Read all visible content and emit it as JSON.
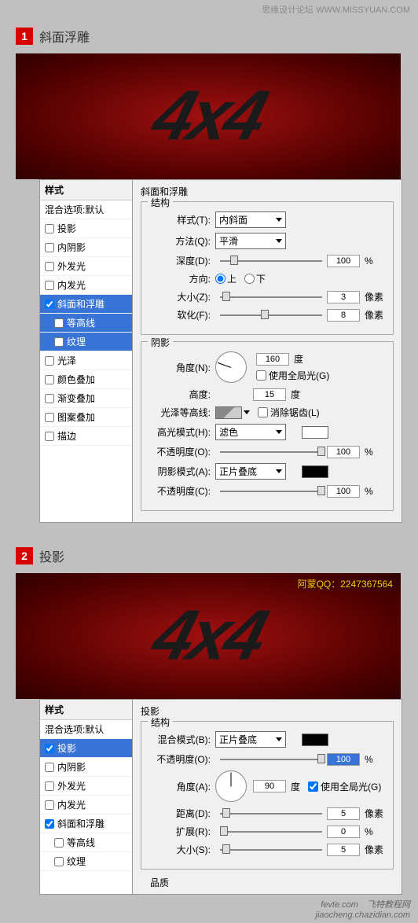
{
  "header_link": "思缘设计论坛 WWW.MISSYUAN.COM",
  "section1": {
    "number": "1",
    "title": "斜面浮雕"
  },
  "section2": {
    "number": "2",
    "title": "投影"
  },
  "preview_text": "4x4",
  "watermark_qq": "阿蒙QQ：2247367564",
  "style_panel": {
    "header": "样式",
    "blend_options": "混合选项:默认",
    "items": {
      "drop_shadow": "投影",
      "inner_shadow": "内阴影",
      "outer_glow": "外发光",
      "inner_glow": "内发光",
      "bevel_emboss": "斜面和浮雕",
      "contour": "等高线",
      "texture": "纹理",
      "satin": "光泽",
      "color_overlay": "颜色叠加",
      "gradient_overlay": "渐变叠加",
      "pattern_overlay": "图案叠加",
      "stroke": "描边"
    }
  },
  "bevel": {
    "panel_title": "斜面和浮雕",
    "structure": "结构",
    "style_label": "样式(T):",
    "style_value": "内斜面",
    "technique_label": "方法(Q):",
    "technique_value": "平滑",
    "depth_label": "深度(D):",
    "depth_value": "100",
    "direction_label": "方向:",
    "direction_up": "上",
    "direction_down": "下",
    "size_label": "大小(Z):",
    "size_value": "3",
    "soften_label": "软化(F):",
    "soften_value": "8",
    "pixel_unit": "像素",
    "percent_unit": "%",
    "shading": "阴影",
    "angle_label": "角度(N):",
    "angle_value": "160",
    "degree_unit": "度",
    "global_light": "使用全局光(G)",
    "altitude_label": "高度:",
    "altitude_value": "15",
    "gloss_contour_label": "光泽等高线:",
    "antialiased": "消除锯齿(L)",
    "highlight_mode_label": "高光模式(H):",
    "highlight_mode_value": "滤色",
    "highlight_opacity_label": "不透明度(O):",
    "highlight_opacity_value": "100",
    "shadow_mode_label": "阴影模式(A):",
    "shadow_mode_value": "正片叠底",
    "shadow_opacity_label": "不透明度(C):",
    "shadow_opacity_value": "100"
  },
  "dropshadow": {
    "panel_title": "投影",
    "structure": "结构",
    "blend_mode_label": "混合模式(B):",
    "blend_mode_value": "正片叠底",
    "opacity_label": "不透明度(O):",
    "opacity_value": "100",
    "angle_label": "角度(A):",
    "angle_value": "90",
    "degree_unit": "度",
    "global_light": "使用全局光(G)",
    "distance_label": "距离(D):",
    "distance_value": "5",
    "spread_label": "扩展(R):",
    "spread_value": "0",
    "size_label": "大小(S):",
    "size_value": "5",
    "pixel_unit": "像素",
    "percent_unit": "%",
    "quality": "品质"
  },
  "footer": {
    "fevte": "fevte.com",
    "site": "飞特教程网",
    "url": "jiaocheng.chazidian.com"
  }
}
